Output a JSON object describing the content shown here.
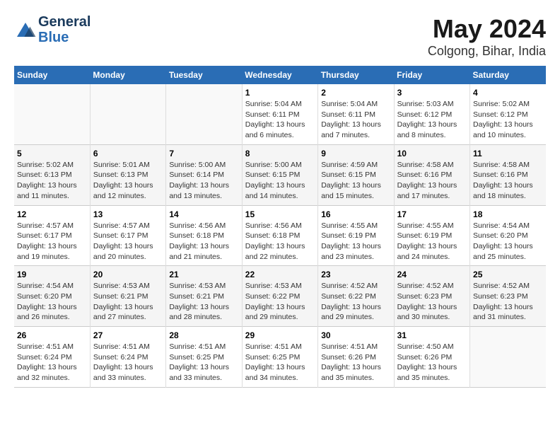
{
  "header": {
    "logo_line1": "General",
    "logo_line2": "Blue",
    "title": "May 2024",
    "subtitle": "Colgong, Bihar, India"
  },
  "calendar": {
    "weekdays": [
      "Sunday",
      "Monday",
      "Tuesday",
      "Wednesday",
      "Thursday",
      "Friday",
      "Saturday"
    ],
    "weeks": [
      [
        {
          "day": "",
          "info": ""
        },
        {
          "day": "",
          "info": ""
        },
        {
          "day": "",
          "info": ""
        },
        {
          "day": "1",
          "info": "Sunrise: 5:04 AM\nSunset: 6:11 PM\nDaylight: 13 hours\nand 6 minutes."
        },
        {
          "day": "2",
          "info": "Sunrise: 5:04 AM\nSunset: 6:11 PM\nDaylight: 13 hours\nand 7 minutes."
        },
        {
          "day": "3",
          "info": "Sunrise: 5:03 AM\nSunset: 6:12 PM\nDaylight: 13 hours\nand 8 minutes."
        },
        {
          "day": "4",
          "info": "Sunrise: 5:02 AM\nSunset: 6:12 PM\nDaylight: 13 hours\nand 10 minutes."
        }
      ],
      [
        {
          "day": "5",
          "info": "Sunrise: 5:02 AM\nSunset: 6:13 PM\nDaylight: 13 hours\nand 11 minutes."
        },
        {
          "day": "6",
          "info": "Sunrise: 5:01 AM\nSunset: 6:13 PM\nDaylight: 13 hours\nand 12 minutes."
        },
        {
          "day": "7",
          "info": "Sunrise: 5:00 AM\nSunset: 6:14 PM\nDaylight: 13 hours\nand 13 minutes."
        },
        {
          "day": "8",
          "info": "Sunrise: 5:00 AM\nSunset: 6:15 PM\nDaylight: 13 hours\nand 14 minutes."
        },
        {
          "day": "9",
          "info": "Sunrise: 4:59 AM\nSunset: 6:15 PM\nDaylight: 13 hours\nand 15 minutes."
        },
        {
          "day": "10",
          "info": "Sunrise: 4:58 AM\nSunset: 6:16 PM\nDaylight: 13 hours\nand 17 minutes."
        },
        {
          "day": "11",
          "info": "Sunrise: 4:58 AM\nSunset: 6:16 PM\nDaylight: 13 hours\nand 18 minutes."
        }
      ],
      [
        {
          "day": "12",
          "info": "Sunrise: 4:57 AM\nSunset: 6:17 PM\nDaylight: 13 hours\nand 19 minutes."
        },
        {
          "day": "13",
          "info": "Sunrise: 4:57 AM\nSunset: 6:17 PM\nDaylight: 13 hours\nand 20 minutes."
        },
        {
          "day": "14",
          "info": "Sunrise: 4:56 AM\nSunset: 6:18 PM\nDaylight: 13 hours\nand 21 minutes."
        },
        {
          "day": "15",
          "info": "Sunrise: 4:56 AM\nSunset: 6:18 PM\nDaylight: 13 hours\nand 22 minutes."
        },
        {
          "day": "16",
          "info": "Sunrise: 4:55 AM\nSunset: 6:19 PM\nDaylight: 13 hours\nand 23 minutes."
        },
        {
          "day": "17",
          "info": "Sunrise: 4:55 AM\nSunset: 6:19 PM\nDaylight: 13 hours\nand 24 minutes."
        },
        {
          "day": "18",
          "info": "Sunrise: 4:54 AM\nSunset: 6:20 PM\nDaylight: 13 hours\nand 25 minutes."
        }
      ],
      [
        {
          "day": "19",
          "info": "Sunrise: 4:54 AM\nSunset: 6:20 PM\nDaylight: 13 hours\nand 26 minutes."
        },
        {
          "day": "20",
          "info": "Sunrise: 4:53 AM\nSunset: 6:21 PM\nDaylight: 13 hours\nand 27 minutes."
        },
        {
          "day": "21",
          "info": "Sunrise: 4:53 AM\nSunset: 6:21 PM\nDaylight: 13 hours\nand 28 minutes."
        },
        {
          "day": "22",
          "info": "Sunrise: 4:53 AM\nSunset: 6:22 PM\nDaylight: 13 hours\nand 29 minutes."
        },
        {
          "day": "23",
          "info": "Sunrise: 4:52 AM\nSunset: 6:22 PM\nDaylight: 13 hours\nand 29 minutes."
        },
        {
          "day": "24",
          "info": "Sunrise: 4:52 AM\nSunset: 6:23 PM\nDaylight: 13 hours\nand 30 minutes."
        },
        {
          "day": "25",
          "info": "Sunrise: 4:52 AM\nSunset: 6:23 PM\nDaylight: 13 hours\nand 31 minutes."
        }
      ],
      [
        {
          "day": "26",
          "info": "Sunrise: 4:51 AM\nSunset: 6:24 PM\nDaylight: 13 hours\nand 32 minutes."
        },
        {
          "day": "27",
          "info": "Sunrise: 4:51 AM\nSunset: 6:24 PM\nDaylight: 13 hours\nand 33 minutes."
        },
        {
          "day": "28",
          "info": "Sunrise: 4:51 AM\nSunset: 6:25 PM\nDaylight: 13 hours\nand 33 minutes."
        },
        {
          "day": "29",
          "info": "Sunrise: 4:51 AM\nSunset: 6:25 PM\nDaylight: 13 hours\nand 34 minutes."
        },
        {
          "day": "30",
          "info": "Sunrise: 4:51 AM\nSunset: 6:26 PM\nDaylight: 13 hours\nand 35 minutes."
        },
        {
          "day": "31",
          "info": "Sunrise: 4:50 AM\nSunset: 6:26 PM\nDaylight: 13 hours\nand 35 minutes."
        },
        {
          "day": "",
          "info": ""
        }
      ]
    ]
  }
}
